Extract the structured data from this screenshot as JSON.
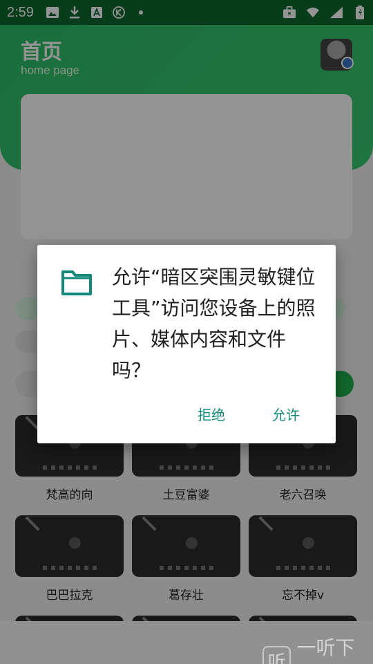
{
  "status_bar": {
    "time": "2:59",
    "left_icons": [
      "image-icon",
      "download-icon",
      "a-badge-icon",
      "k-circle-icon",
      "dot-icon"
    ],
    "right_icons": [
      "briefcase-icon",
      "wifi-icon",
      "signal-icon",
      "battery-icon"
    ],
    "bg_color": "#0f6a2f"
  },
  "header": {
    "title": "首页",
    "subtitle": "home page",
    "accent_color": "#2fbf69"
  },
  "cards": [
    {
      "label": "梵高的向"
    },
    {
      "label": "土豆富婆"
    },
    {
      "label": "老六召唤"
    },
    {
      "label": "巴巴拉克"
    },
    {
      "label": "葛存壮"
    },
    {
      "label": "忘不掉v"
    }
  ],
  "dialog": {
    "message": "允许“暗区突围灵敏键位工具”访问您设备上的照片、媒体内容和文件吗？",
    "deny_label": "拒绝",
    "allow_label": "允许",
    "button_color": "#12897a",
    "icon": "folder-icon"
  },
  "watermark": {
    "logo_char": "听",
    "text": "一听下载"
  }
}
